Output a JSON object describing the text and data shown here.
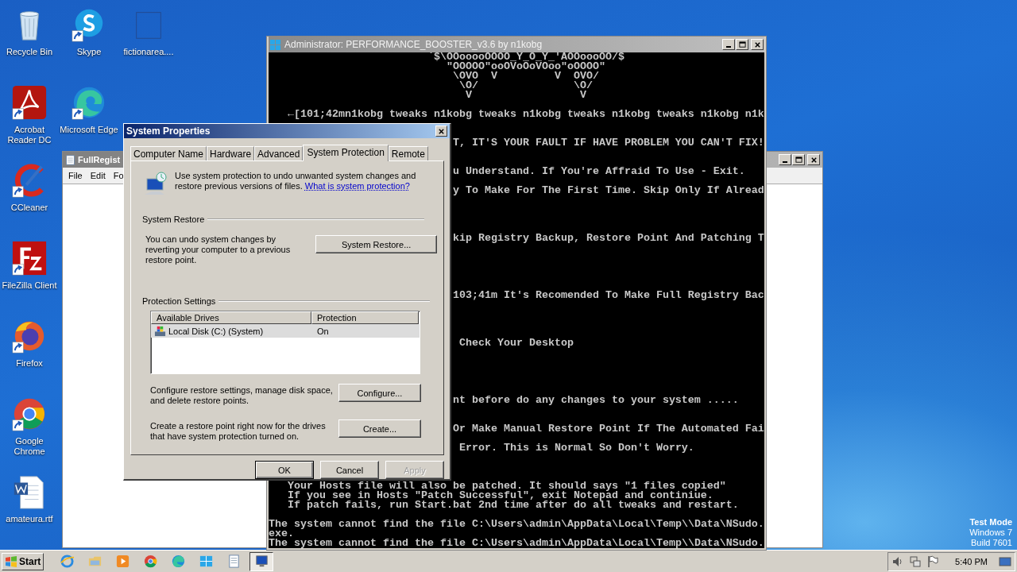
{
  "desktop_icons": [
    {
      "kind": "recycle",
      "label": "Recycle Bin",
      "shortcut": false
    },
    {
      "kind": "skype",
      "label": "Skype",
      "shortcut": true
    },
    {
      "kind": "blank",
      "label": "fictionarea....",
      "shortcut": false
    },
    {
      "kind": "acrobat",
      "label": "Acrobat Reader DC",
      "shortcut": true
    },
    {
      "kind": "edge",
      "label": "Microsoft Edge",
      "shortcut": true
    },
    {
      "kind": "ccleaner",
      "label": "CCleaner",
      "shortcut": true
    },
    {
      "kind": "filezilla",
      "label": "FileZilla Client",
      "shortcut": true
    },
    {
      "kind": "firefox",
      "label": "Firefox",
      "shortcut": true
    },
    {
      "kind": "chrome",
      "label": "Google Chrome",
      "shortcut": true
    },
    {
      "kind": "word",
      "label": "amateura.rtf",
      "shortcut": false
    }
  ],
  "notepad": {
    "title": "FullRegist",
    "menu": [
      "File",
      "Edit",
      "Fo"
    ]
  },
  "console": {
    "title": "Administrator:  PERFORMANCE_BOOSTER_v3.6 by n1kobg",
    "lines": [
      "`$\\OOooooOOOO_Y_O_Y_'AOOoooOO/$",
      "\"OOOOO\"ooOVoOoVOoo\"oOOOO\"",
      "\\OVO  V         V  OVO/",
      "\\O/               \\O/",
      "V                 V",
      "←[101;42mn1kobg tweaks n1kobg tweaks n1kobg tweaks n1kobg tweaks n1kobg n1k",
      "T, IT'S YOUR FAULT IF HAVE PROBLEM YOU CAN'T FIX!",
      "u Understand. If You're Affraid To Use - Exit.",
      "y To Make For The First Time. Skip Only If Alread",
      "kip Registry Backup, Restore Point And Patching T",
      "103;41m It's Recomended To Make Full Registry Bac",
      "Check Your Desktop",
      "nt before do any changes to your system .....",
      "Or Make Manual Restore Point If The Automated Fai",
      "Error. This is Normal So Don't Worry.",
      "Your Hosts file will also be patched. It should says \"1 files copied\"",
      "If you see in Hosts \"Patch Successful\", exit Notepad and continiue.",
      "If patch fails, run Start.bat 2nd time after do all tweaks and restart.",
      "The system cannot find the file C:\\Users\\admin\\AppData\\Local\\Temp\\\\Data\\NSudo.",
      "exe.",
      "The system cannot find the file C:\\Users\\admin\\AppData\\Local\\Temp\\\\Data\\NSudo."
    ]
  },
  "dialog": {
    "title": "System Properties",
    "tabs": [
      {
        "label": "Computer Name",
        "selected": false
      },
      {
        "label": "Hardware",
        "selected": false
      },
      {
        "label": "Advanced",
        "selected": false
      },
      {
        "label": "System Protection",
        "selected": true
      },
      {
        "label": "Remote",
        "selected": false
      }
    ],
    "intro": "Use system protection to undo unwanted system changes and restore previous versions of files.",
    "intro_link": "What is system protection?",
    "system_restore": {
      "heading": "System Restore",
      "text": "You can undo system changes by reverting your computer to a previous restore point.",
      "button": "System Restore..."
    },
    "protection_settings": {
      "heading": "Protection Settings",
      "columns": [
        "Available Drives",
        "Protection"
      ],
      "rows": [
        {
          "drive": "Local Disk (C:) (System)",
          "protection": "On",
          "selected": true
        }
      ],
      "configure_text": "Configure restore settings, manage disk space, and delete restore points.",
      "configure_button": "Configure...",
      "create_text": "Create a restore point right now for the drives that have system protection turned on.",
      "create_button": "Create..."
    },
    "buttons": [
      {
        "label": "OK",
        "disabled": false
      },
      {
        "label": "Cancel",
        "disabled": false
      },
      {
        "label": "Apply",
        "disabled": true
      }
    ]
  },
  "test_mode": [
    "Test Mode",
    "Windows 7",
    "Build 7601"
  ],
  "taskbar": {
    "start": "Start",
    "apps": [
      {
        "kind": "ie",
        "active": false
      },
      {
        "kind": "folder",
        "active": false
      },
      {
        "kind": "media",
        "active": false
      },
      {
        "kind": "chrome",
        "active": false
      },
      {
        "kind": "edge",
        "active": false
      },
      {
        "kind": "windows",
        "active": false
      },
      {
        "kind": "notepad",
        "active": false
      },
      {
        "kind": "monitor",
        "active": true
      }
    ],
    "clock": "5:40 PM"
  }
}
